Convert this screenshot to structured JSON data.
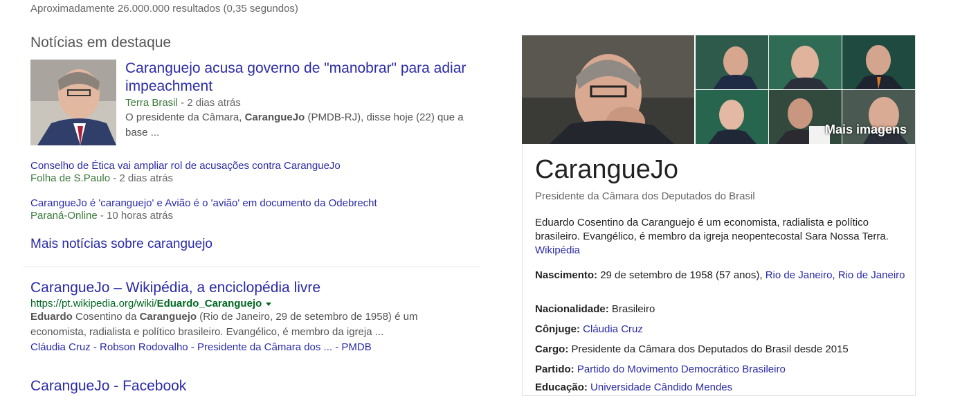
{
  "stats": "Aproximadamente 26.000.000 resultados (0,35 segundos)",
  "top_stories": {
    "heading": "Notícias em destaque",
    "main": {
      "title": "Caranguejo acusa governo de \"manobrar\" para adiar impeachment",
      "source": "Terra Brasil",
      "time": " - 2 dias atrás",
      "snippet_pre": "O presidente da Câmara, ",
      "snippet_bold": "CarangueJo",
      "snippet_post": " (PMDB-RJ), disse hoje (22) que a base ..."
    },
    "sub": [
      {
        "title": "Conselho de Ética vai ampliar rol de acusações contra CarangueJo",
        "source": "Folha de S.Paulo",
        "time": " - 2 dias atrás"
      },
      {
        "title": "CarangueJo é 'caranguejo' e Avião é o 'avião' em documento da Odebrecht",
        "source": "Paraná-Online",
        "time": " - 10 horas atrás"
      }
    ],
    "more": "Mais notícias sobre caranguejo"
  },
  "result1": {
    "title": "CarangueJo – Wikipédia, a enciclopédia livre",
    "url_pre": "https://pt.wikipedia.org/wiki/",
    "url_bold": "Eduardo_Caranguejo",
    "snippet_b1": "Eduardo",
    "snippet_t1": " Cosentino da ",
    "snippet_b2": "Caranguejo",
    "snippet_t2": " (Rio de Janeiro, 29 de setembro de 1958) é um economista, radialista e político brasileiro. Evangélico, é membro da igreja ...",
    "sitelinks": "Cláudia Cruz - Robson Rodovalho - Presidente da Câmara dos ... - PMDB"
  },
  "result2": {
    "title": "CarangueJo - Facebook"
  },
  "knowledge_panel": {
    "more_images": "Mais imagens",
    "title": "CarangueJo",
    "subtitle": "Presidente da Câmara dos Deputados do Brasil",
    "description": "Eduardo Cosentino da Caranguejo é um economista, radialista e político brasileiro. Evangélico, é membro da igreja neopentecostal Sara Nossa Terra. ",
    "description_source": "Wikipédia",
    "facts": {
      "birth_label": "Nascimento:",
      "birth_value": " 29 de setembro de 1958 (57 anos), ",
      "birth_place": "Rio de Janeiro, Rio de Janeiro",
      "nationality_label": "Nacionalidade:",
      "nationality_value": " Brasileiro",
      "spouse_label": "Cônjuge:",
      "spouse_value": "Cláudia Cruz",
      "office_label": "Cargo:",
      "office_value": " Presidente da Câmara dos Deputados do Brasil desde 2015",
      "party_label": "Partido:",
      "party_value": "Partido do Movimento Democrático Brasileiro",
      "education_label": "Educação:",
      "education_value": "Universidade Cândido Mendes"
    }
  },
  "colors": {
    "link": "#2a2aa8",
    "url_green": "#006621",
    "source_green": "#3b7a3b"
  }
}
